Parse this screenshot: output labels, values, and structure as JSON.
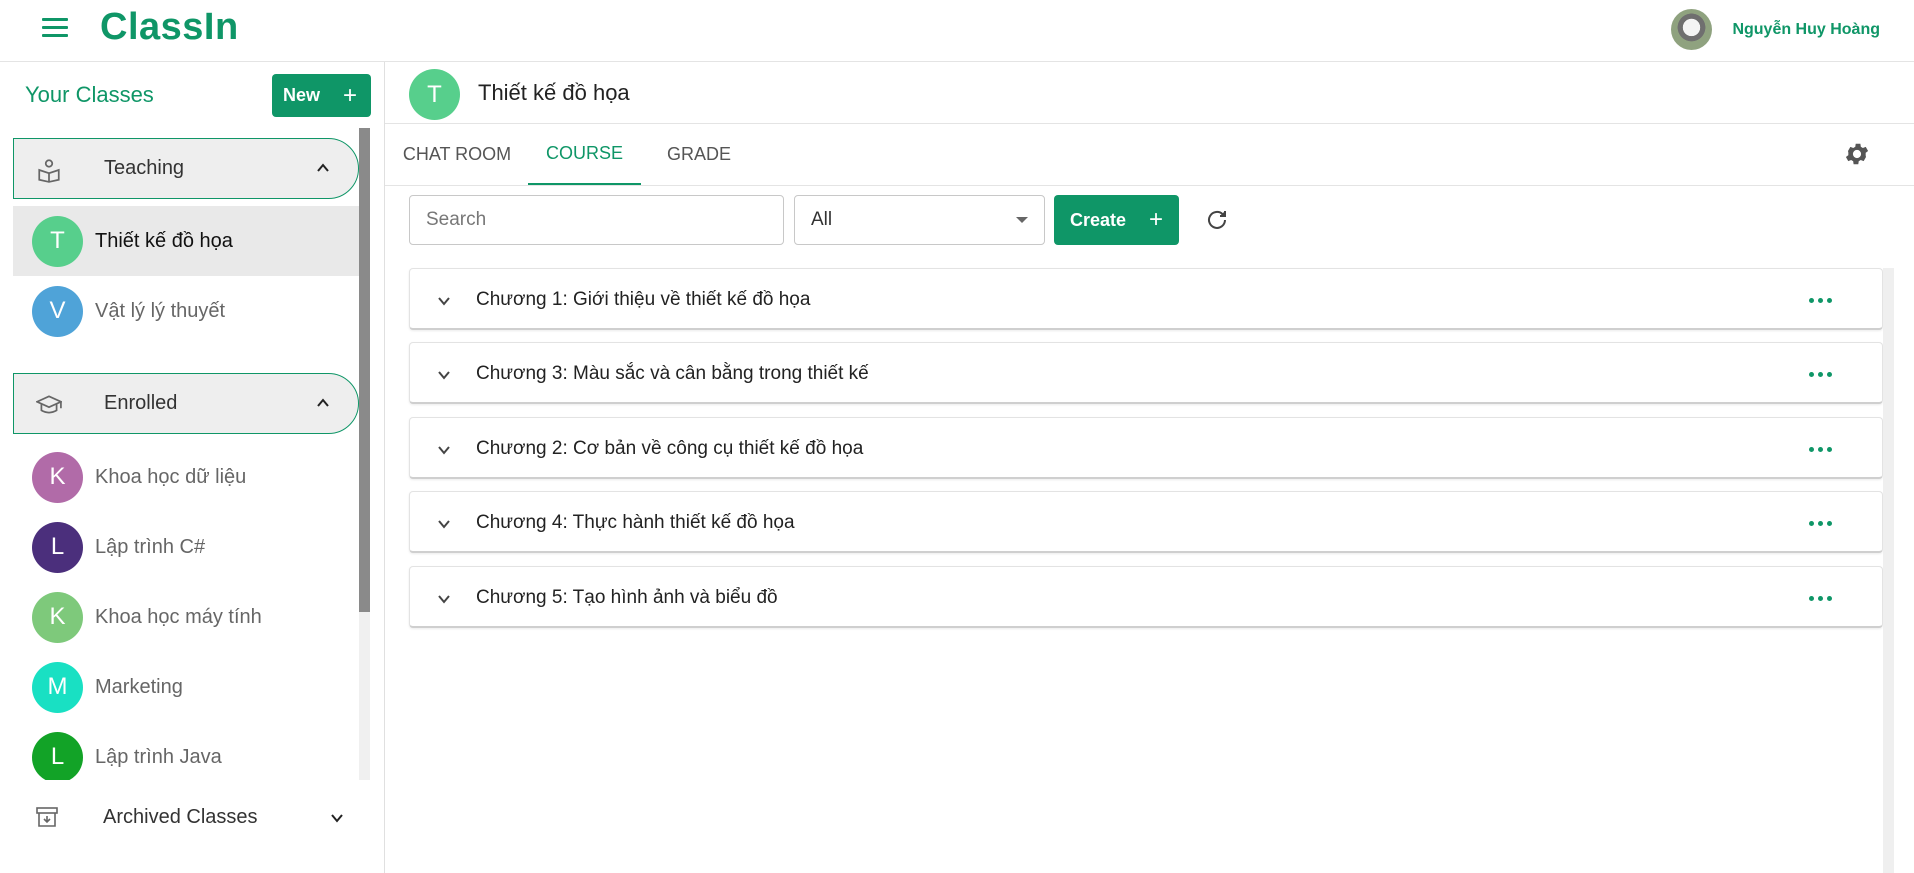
{
  "app": {
    "brand": "ClassIn",
    "user_name": "Nguyễn Huy Hoàng"
  },
  "colors": {
    "accent": "#0f9667",
    "teaching_avatar": "#57cf8c"
  },
  "sidebar": {
    "heading": "Your Classes",
    "new_label": "New",
    "teaching": {
      "label": "Teaching",
      "items": [
        {
          "letter": "T",
          "name": "Thiết kế đồ họa",
          "color": "#57cf8c",
          "active": true
        },
        {
          "letter": "V",
          "name": "Vật lý lý thuyết",
          "color": "#4fa3d8",
          "active": false
        }
      ]
    },
    "enrolled": {
      "label": "Enrolled",
      "items": [
        {
          "letter": "K",
          "name": "Khoa học dữ liệu",
          "color": "#b16ba8"
        },
        {
          "letter": "L",
          "name": "Lập trình C#",
          "color": "#4b2f7c"
        },
        {
          "letter": "K",
          "name": "Khoa học máy tính",
          "color": "#7ec97b"
        },
        {
          "letter": "M",
          "name": "Marketing",
          "color": "#19e0c3"
        },
        {
          "letter": "L",
          "name": "Lập trình Java",
          "color": "#12a327"
        }
      ]
    },
    "archived_label": "Archived Classes"
  },
  "class_header": {
    "letter": "T",
    "title": "Thiết kế đồ họa"
  },
  "tabs": [
    {
      "label": "CHAT ROOM",
      "active": false
    },
    {
      "label": "COURSE",
      "active": true
    },
    {
      "label": "GRADE",
      "active": false
    }
  ],
  "toolbar": {
    "search_placeholder": "Search",
    "filter_value": "All",
    "create_label": "Create"
  },
  "chapters": [
    "Chương 1: Giới thiệu về thiết kế đồ họa",
    "Chương 3: Màu sắc và cân bằng trong thiết kế",
    "Chương 2: Cơ bản về công cụ thiết kế đồ họa",
    "Chương 4: Thực hành thiết kế đồ họa",
    "Chương 5: Tạo hình ảnh và biểu đồ"
  ]
}
